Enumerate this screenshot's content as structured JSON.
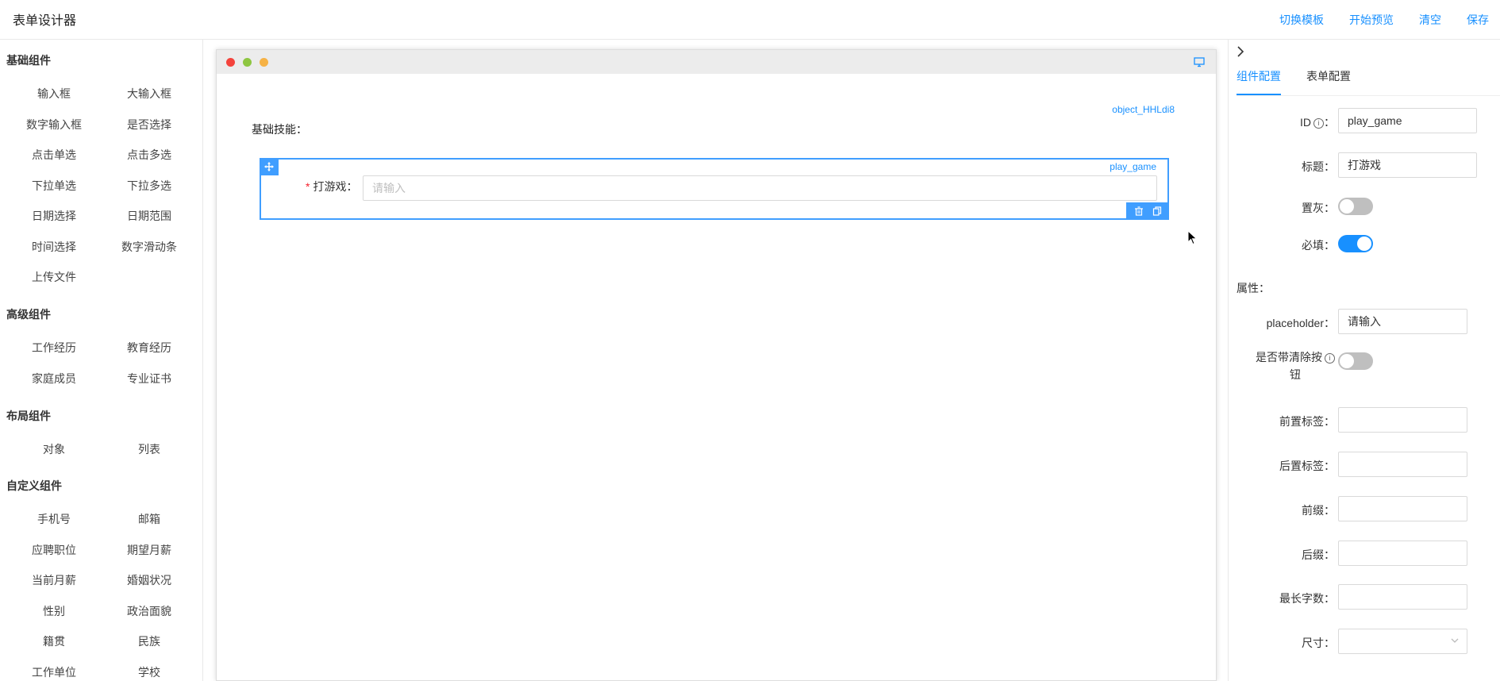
{
  "header": {
    "title": "表单设计器",
    "actions": [
      "切换模板",
      "开始预览",
      "清空",
      "保存"
    ]
  },
  "left_panel": {
    "groups": [
      {
        "title": "基础组件",
        "items": [
          "输入框",
          "大输入框",
          "数字输入框",
          "是否选择",
          "点击单选",
          "点击多选",
          "下拉单选",
          "下拉多选",
          "日期选择",
          "日期范围",
          "时间选择",
          "数字滑动条",
          "上传文件"
        ]
      },
      {
        "title": "高级组件",
        "items": [
          "工作经历",
          "教育经历",
          "家庭成员",
          "专业证书"
        ]
      },
      {
        "title": "布局组件",
        "items": [
          "对象",
          "列表"
        ]
      },
      {
        "title": "自定义组件",
        "items": [
          "手机号",
          "邮箱",
          "应聘职位",
          "期望月薪",
          "当前月薪",
          "婚姻状况",
          "性别",
          "政治面貌",
          "籍贯",
          "民族",
          "工作单位",
          "学校"
        ]
      }
    ]
  },
  "canvas": {
    "object_id": "object_HHLdi8",
    "section_label": "基础技能：",
    "field": {
      "id": "play_game",
      "required_mark": "*",
      "label": "打游戏：",
      "placeholder": "请输入"
    }
  },
  "right_panel": {
    "tabs": [
      "组件配置",
      "表单配置"
    ],
    "active_tab": "组件配置",
    "id_label": "ID",
    "id_suffix": "：",
    "id_value": "play_game",
    "title_label": "标题：",
    "title_value": "打游戏",
    "disabled_label": "置灰：",
    "disabled_on": false,
    "required_label": "必填：",
    "required_on": true,
    "attributes_title": "属性：",
    "placeholder_label": "placeholder：",
    "placeholder_value": "请输入",
    "clear_label_1": "是否带清除按",
    "clear_label_2": "钮",
    "clear_on": false,
    "addon_before_label": "前置标签：",
    "addon_after_label": "后置标签：",
    "prefix_label": "前缀：",
    "suffix_label": "后缀：",
    "maxlength_label": "最长字数：",
    "size_label": "尺寸："
  },
  "colors": {
    "accent": "#1890ff",
    "selected_border": "#409eff",
    "required": "#f5222d"
  }
}
